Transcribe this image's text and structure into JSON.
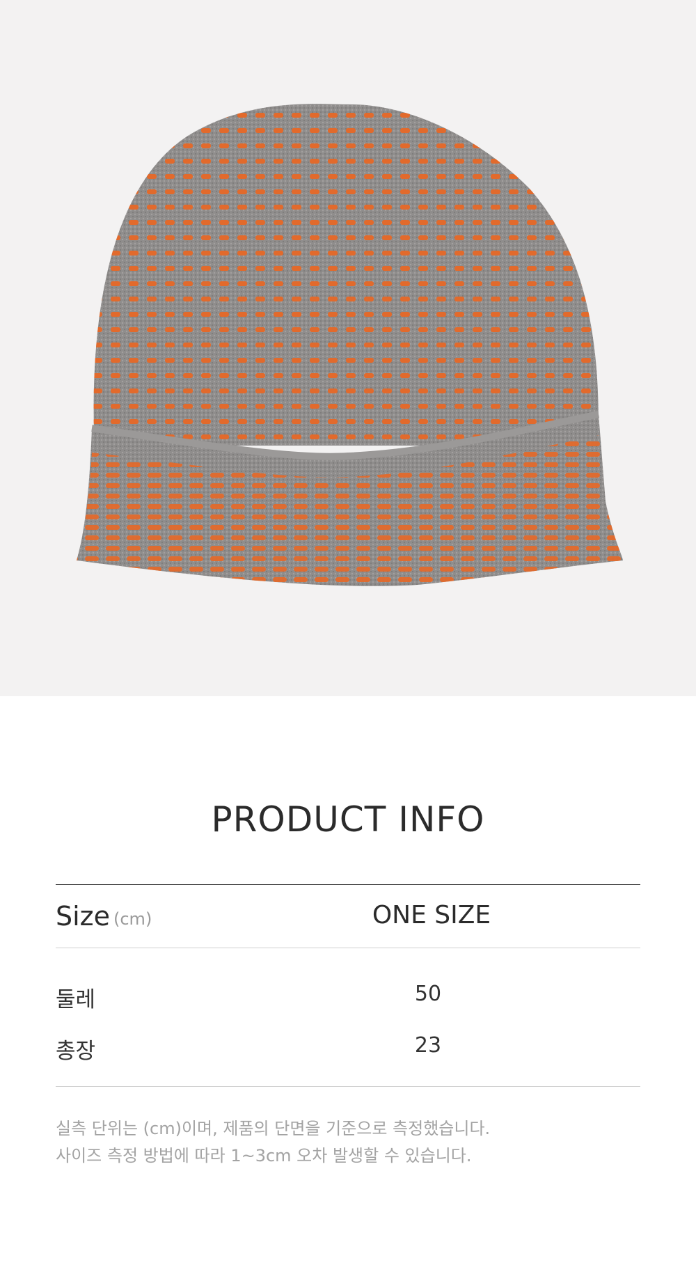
{
  "product_image": {
    "alt_icon": "knit-beanie-photo",
    "colors": {
      "background": "#f3f2f2",
      "knit_gray": "#8e8c8b",
      "knit_orange": "#e26a2c"
    }
  },
  "info": {
    "title": "PRODUCT INFO",
    "size_label": "Size",
    "size_unit": "(cm)",
    "size_value": "ONE SIZE",
    "rows": [
      {
        "label": "둘레",
        "value": "50"
      },
      {
        "label": "총장",
        "value": "23"
      }
    ],
    "notes": [
      "실측 단위는 (cm)이며, 제품의 단면을 기준으로 측정했습니다.",
      "사이즈 측정 방법에 따라 1~3cm 오차 발생할 수 있습니다."
    ]
  }
}
